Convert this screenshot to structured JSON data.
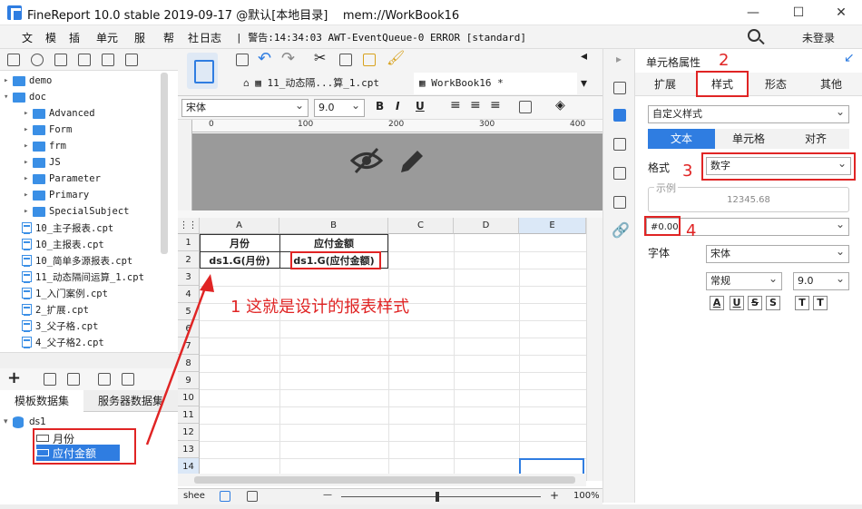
{
  "window": {
    "title": "FineReport 10.0 stable 2019-09-17 @默认[本地目录]    mem://WorkBook16",
    "minimize": "—",
    "maximize": "☐",
    "close": "✕"
  },
  "menu": {
    "items": [
      "文",
      "模",
      "插",
      "单元",
      "服",
      "帮",
      "社"
    ],
    "log_label": "日志",
    "log_line": "| 警告:14:34:03 AWT-EventQueue-0 ERROR [standard]",
    "login": "未登录"
  },
  "tree": {
    "folders": [
      {
        "name": "demo",
        "level": 0,
        "expanded": false
      },
      {
        "name": "doc",
        "level": 0,
        "expanded": true
      },
      {
        "name": "Advanced",
        "level": 1
      },
      {
        "name": "Form",
        "level": 1
      },
      {
        "name": "frm",
        "level": 1
      },
      {
        "name": "JS",
        "level": 1
      },
      {
        "name": "Parameter",
        "level": 1
      },
      {
        "name": "Primary",
        "level": 1
      },
      {
        "name": "SpecialSubject",
        "level": 1
      }
    ],
    "files": [
      "10_主子报表.cpt",
      "10_主报表.cpt",
      "10_简单多源报表.cpt",
      "11_动态隔间运算_1.cpt",
      "1_入门案例.cpt",
      "2_扩展.cpt",
      "3_父子格.cpt",
      "4_父子格2.cpt"
    ]
  },
  "dataset": {
    "tabs": [
      "模板数据集",
      "服务器数据集"
    ],
    "root": "ds1",
    "fields": [
      "月份",
      "应付金额"
    ]
  },
  "tabs": [
    {
      "label": "11_动态隔...算_1.cpt"
    },
    {
      "label": "WorkBook16 *"
    }
  ],
  "format": {
    "font": "宋体",
    "size": "9.0",
    "bold": "B",
    "italic": "I",
    "underline": "U"
  },
  "ruler": {
    "ticks": [
      "0",
      "100",
      "200",
      "300",
      "400"
    ]
  },
  "grid": {
    "columns": [
      "A",
      "B",
      "C",
      "D",
      "E"
    ],
    "rows": [
      "1",
      "2",
      "3",
      "4",
      "5",
      "6",
      "7",
      "8",
      "9",
      "10",
      "11",
      "12",
      "13",
      "14"
    ],
    "a1": "月份",
    "b1": "应付金额",
    "a2": "ds1.G(月份)",
    "b2": "ds1.G(应付金额)"
  },
  "sheet": {
    "name": "shee",
    "zoom": "100%",
    "minus": "—",
    "plus": "+"
  },
  "right_panel": {
    "title": "单元格属性",
    "tabs": [
      "扩展",
      "样式",
      "形态",
      "其他"
    ],
    "style_select": "自定义样式",
    "subtabs": [
      "文本",
      "单元格",
      "对齐"
    ],
    "format_label": "格式",
    "format_value": "数字",
    "example_label": "示例",
    "example_value": "12345.68",
    "pattern": "#0.00",
    "font_label": "字体",
    "font_value": "宋体",
    "font_style": "常规",
    "font_size": "9.0",
    "style_buttons": [
      "A",
      "U",
      "S",
      "S",
      "T",
      "T"
    ]
  },
  "annotations": {
    "n1": "1 这就是设计的报表样式",
    "n2": "2",
    "n3": "3",
    "n4": "4"
  },
  "colors": {
    "accent": "#2f7de1",
    "annotation": "#e02424",
    "designer_bg": "#9a9a9a"
  }
}
